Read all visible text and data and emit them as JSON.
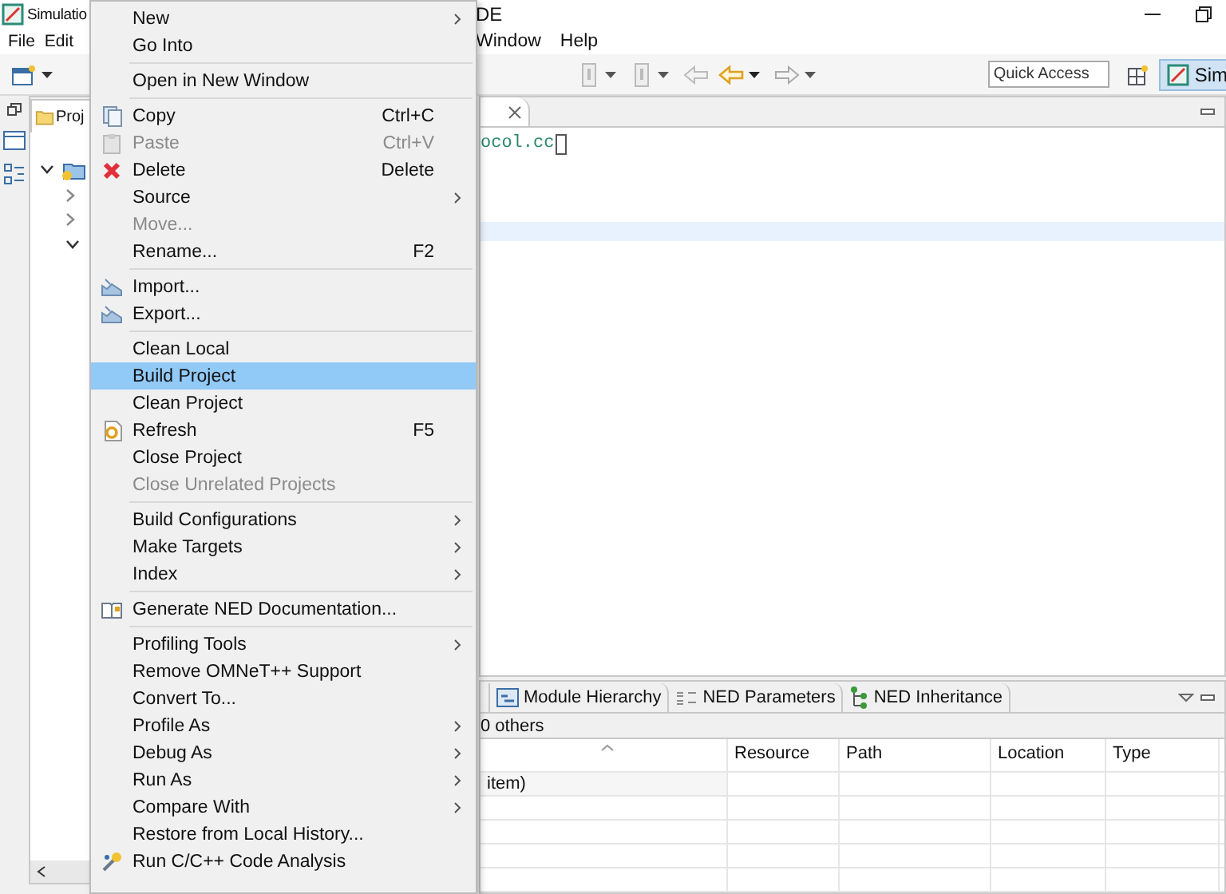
{
  "window": {
    "title": [
      "Simulatio",
      "DE"
    ]
  },
  "menu_bar": [
    "File",
    "Edit",
    "Window",
    "Help"
  ],
  "toolbar": {
    "quick_access": {
      "placeholder": "Quick Access"
    },
    "perspective": "Sim"
  },
  "project_explorer": {
    "tab": "Proj"
  },
  "editor": {
    "code": "ocol.cc"
  },
  "bottom_panel": {
    "tabs": [
      {
        "label": "Module Hierarchy",
        "kind": "hierarchy",
        "selected": false
      },
      {
        "label": "NED Parameters",
        "kind": "parameters",
        "selected": false
      },
      {
        "label": "NED Inheritance",
        "kind": "inheritance",
        "selected": false
      }
    ],
    "filter_text": "0 others",
    "table": {
      "columns": [
        "Resource",
        "Path",
        "Location",
        "Type"
      ],
      "rows": [
        {
          "column_1": "item)"
        }
      ]
    }
  },
  "context_menu": {
    "groups": [
      [
        {
          "label": "New",
          "submenu": true,
          "disabled": false,
          "selected": false
        },
        {
          "label": "Go Into",
          "submenu": false,
          "disabled": false,
          "selected": false
        }
      ],
      [
        {
          "label": "Open in New Window",
          "submenu": false,
          "disabled": false,
          "selected": false
        }
      ],
      [
        {
          "label": "Copy",
          "shortcut": "Ctrl+C",
          "kind": "copy",
          "submenu": false,
          "disabled": false,
          "selected": false
        },
        {
          "label": "Paste",
          "shortcut": "Ctrl+V",
          "kind": "paste",
          "submenu": false,
          "disabled": true,
          "selected": false
        },
        {
          "label": "Delete",
          "shortcut": "Delete",
          "kind": "delete",
          "submenu": false,
          "disabled": false,
          "selected": false
        },
        {
          "label": "Source",
          "submenu": true,
          "disabled": false,
          "selected": false
        },
        {
          "label": "Move...",
          "submenu": false,
          "disabled": true,
          "selected": false
        },
        {
          "label": "Rename...",
          "shortcut": "F2",
          "submenu": false,
          "disabled": false,
          "selected": false
        }
      ],
      [
        {
          "label": "Import...",
          "kind": "import",
          "submenu": false,
          "disabled": false,
          "selected": false
        },
        {
          "label": "Export...",
          "kind": "export",
          "submenu": false,
          "disabled": false,
          "selected": false
        }
      ],
      [
        {
          "label": "Clean Local",
          "submenu": false,
          "disabled": false,
          "selected": false
        },
        {
          "label": "Build Project",
          "submenu": false,
          "disabled": false,
          "selected": true
        },
        {
          "label": "Clean Project",
          "submenu": false,
          "disabled": false,
          "selected": false
        },
        {
          "label": "Refresh",
          "shortcut": "F5",
          "kind": "refresh",
          "submenu": false,
          "disabled": false,
          "selected": false
        },
        {
          "label": "Close Project",
          "submenu": false,
          "disabled": false,
          "selected": false
        },
        {
          "label": "Close Unrelated Projects",
          "submenu": false,
          "disabled": true,
          "selected": false
        }
      ],
      [
        {
          "label": "Build Configurations",
          "submenu": true,
          "disabled": false,
          "selected": false
        },
        {
          "label": "Make Targets",
          "submenu": true,
          "disabled": false,
          "selected": false
        },
        {
          "label": "Index",
          "submenu": true,
          "disabled": false,
          "selected": false
        }
      ],
      [
        {
          "label": "Generate NED Documentation...",
          "kind": "documentation",
          "submenu": false,
          "disabled": false,
          "selected": false
        }
      ],
      [
        {
          "label": "Profiling Tools",
          "submenu": true,
          "disabled": false,
          "selected": false
        },
        {
          "label": "Remove OMNeT++ Support",
          "submenu": false,
          "disabled": false,
          "selected": false
        },
        {
          "label": "Convert To...",
          "submenu": false,
          "disabled": false,
          "selected": false
        },
        {
          "label": "Profile As",
          "submenu": true,
          "disabled": false,
          "selected": false
        },
        {
          "label": "Debug As",
          "submenu": true,
          "disabled": false,
          "selected": false
        },
        {
          "label": "Run As",
          "submenu": true,
          "disabled": false,
          "selected": false
        },
        {
          "label": "Compare With",
          "submenu": true,
          "disabled": false,
          "selected": false
        },
        {
          "label": "Restore from Local History...",
          "submenu": false,
          "disabled": false,
          "selected": false
        },
        {
          "label": "Run C/C++ Code Analysis",
          "kind": "analysis",
          "submenu": false,
          "disabled": false,
          "selected": false
        }
      ]
    ]
  }
}
